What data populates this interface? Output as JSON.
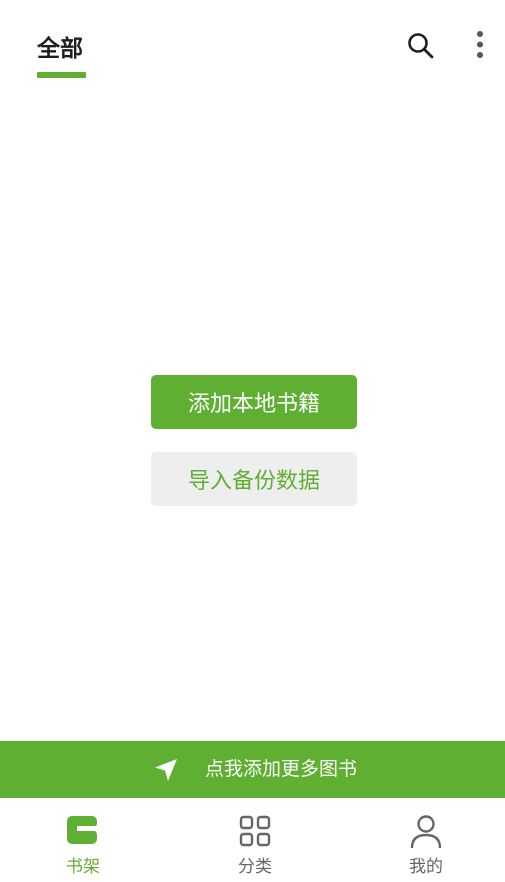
{
  "header": {
    "tab_label": "全部",
    "search_icon": "search-icon",
    "more_icon": "more-vert-icon"
  },
  "empty_state": {
    "add_local_label": "添加本地书籍",
    "import_backup_label": "导入备份数据"
  },
  "banner": {
    "icon": "send-arrow-icon",
    "text": "点我添加更多图书"
  },
  "bottom_nav": {
    "items": [
      {
        "label": "书架",
        "icon": "bookshelf-icon",
        "active": true
      },
      {
        "label": "分类",
        "icon": "grid-icon",
        "active": false
      },
      {
        "label": "我的",
        "icon": "person-icon",
        "active": false
      }
    ]
  },
  "colors": {
    "accent": "#5faf32",
    "secondary_button_bg": "#eeeeee",
    "inactive_nav": "#666666"
  }
}
